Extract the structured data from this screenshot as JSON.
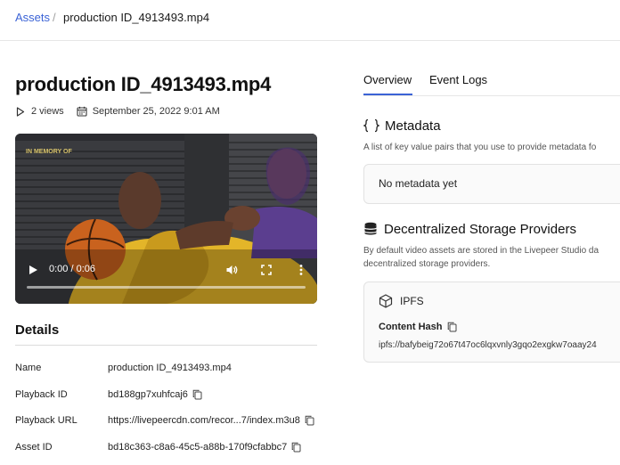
{
  "breadcrumb": {
    "root": "Assets",
    "separator": "/",
    "current": "production ID_4913493.mp4"
  },
  "asset": {
    "title": "production ID_4913493.mp4",
    "views": "2 views",
    "created": "September 25, 2022 9:01 AM"
  },
  "video": {
    "time": "0:00 / 0:06",
    "overlay_text": "IN MEMORY OF"
  },
  "details": {
    "heading": "Details",
    "rows": [
      {
        "label": "Name",
        "value": "production ID_4913493.mp4"
      },
      {
        "label": "Playback ID",
        "value": "bd188gp7xuhfcaj6"
      },
      {
        "label": "Playback URL",
        "value": "https://livepeercdn.com/recor...7/index.m3u8"
      },
      {
        "label": "Asset ID",
        "value": "bd18c363-c8a6-45c5-a88b-170f9cfabbc7"
      }
    ]
  },
  "tabs": [
    {
      "label": "Overview",
      "active": true
    },
    {
      "label": "Event Logs",
      "active": false
    }
  ],
  "metadata": {
    "title": "Metadata",
    "description": "A list of key value pairs that you use to provide metadata fo",
    "empty_text": "No metadata yet"
  },
  "storage": {
    "title": "Decentralized Storage Providers",
    "description_line1": "By default video assets are stored in the Livepeer Studio da",
    "description_line2": "decentralized storage providers.",
    "provider": "IPFS",
    "hash_label": "Content Hash",
    "hash_value": "ipfs://bafybeig72o67t47oc6lqxvnly3gqo2exgkw7oaay24"
  },
  "colors": {
    "accent": "#3b63d6",
    "border": "#e2e2e2",
    "card_bg": "#fafafa"
  }
}
